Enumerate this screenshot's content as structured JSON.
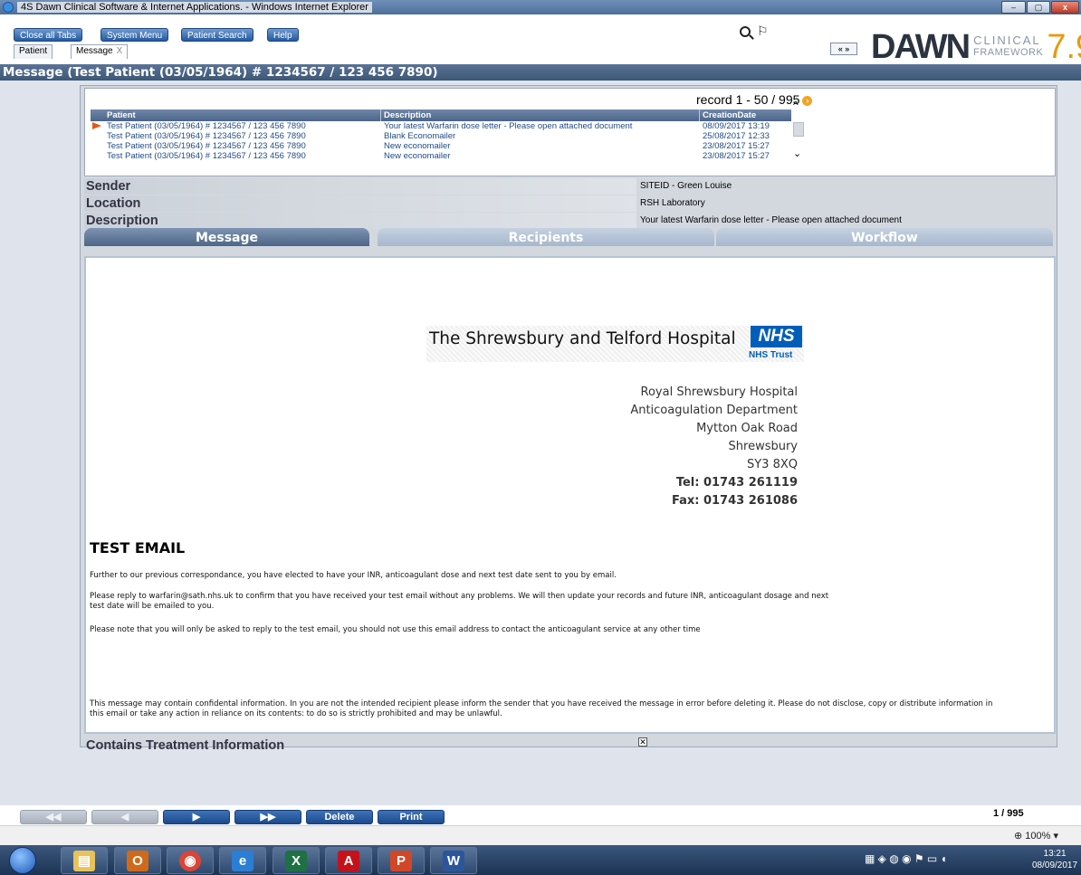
{
  "window": {
    "title": "4S Dawn Clinical Software & Internet Applications. - Windows Internet Explorer",
    "minimize": "–",
    "maximize": "▢",
    "close": "x"
  },
  "menu": {
    "buttons": [
      "Close all Tabs",
      "System Menu",
      "Patient Search",
      "Help"
    ],
    "tabs": [
      {
        "label": "Patient"
      },
      {
        "label": "Message",
        "close": "X"
      }
    ],
    "nav_arrows": "« »"
  },
  "logo": {
    "name": "DAWN",
    "line1": "CLINICAL",
    "line2": "FRAMEWORK",
    "version": "7.9"
  },
  "header": {
    "title": "Message (Test Patient (03/05/1964)    # 1234567  /   123 456 7890)"
  },
  "grid": {
    "record_count": "record 1 - 50 / 995",
    "columns": [
      "Patient",
      "Description",
      "CreationDate"
    ],
    "rows": [
      {
        "patient": "Test Patient (03/05/1964)    # 1234567  /   123 456 7890",
        "description": "Your latest Warfarin dose letter - Please open attached document",
        "date": "08/09/2017 13:19",
        "selected": true
      },
      {
        "patient": "Test Patient (03/05/1964)    # 1234567  /   123 456 7890",
        "description": "Blank Economailer",
        "date": "25/08/2017 12:33",
        "selected": false
      },
      {
        "patient": "Test Patient (03/05/1964)    # 1234567  /   123 456 7890",
        "description": "New economailer",
        "date": "23/08/2017 15:27",
        "selected": false
      },
      {
        "patient": "Test Patient (03/05/1964)    # 1234567  /   123 456 7890",
        "description": "New economailer",
        "date": "23/08/2017 15:27",
        "selected": false
      }
    ]
  },
  "fields": {
    "sender": {
      "label": "Sender",
      "value": "SITEID - Green Louise"
    },
    "location": {
      "label": "Location",
      "value": "RSH Laboratory"
    },
    "description": {
      "label": "Description",
      "value": "Your latest Warfarin dose letter - Please open attached document"
    }
  },
  "tabs": [
    "Message",
    "Recipients",
    "Workflow"
  ],
  "letter": {
    "hospital": "The Shrewsbury and Telford Hospital",
    "nhs": "NHS",
    "nhs_trust": "NHS Trust",
    "address": [
      "Royal Shrewsbury Hospital",
      "Anticoagulation Department",
      "Mytton Oak Road",
      "Shrewsbury",
      "SY3 8XQ"
    ],
    "tel": "Tel: 01743 261119",
    "fax": "Fax: 01743 261086",
    "heading": "TEST EMAIL",
    "p1": "Further to our previous correspondance, you have elected to have your INR, anticoagulant dose and next test date sent to you by email.",
    "p2": "Please reply to warfarin@sath.nhs.uk to confirm that you have received your test email without any problems. We will then update your records and future INR, anticoagulant dosage and next test date will be emailed to you.",
    "p3": "Please note that you will only be asked to reply to the test email, you should not use this email address to contact the anticoagulant service at any other time",
    "p4": "This message may contain confidental information. In you are not the intended recipient please inform the sender that you have received the message in error before deleting it. Please do not disclose, copy or distribute information in this email or take any action in reliance on its contents: to do so is strictly prohibited and may be unlawful."
  },
  "treatment": {
    "label": "Contains Treatment Information",
    "checked": true
  },
  "nav": {
    "first": "◀◀",
    "prev": "◀",
    "next": "▶",
    "last": "▶▶",
    "delete": "Delete",
    "print": "Print",
    "page": "1 / 995"
  },
  "status": {
    "zoom": "100%"
  },
  "clock": {
    "time": "13:21",
    "date": "08/09/2017"
  }
}
